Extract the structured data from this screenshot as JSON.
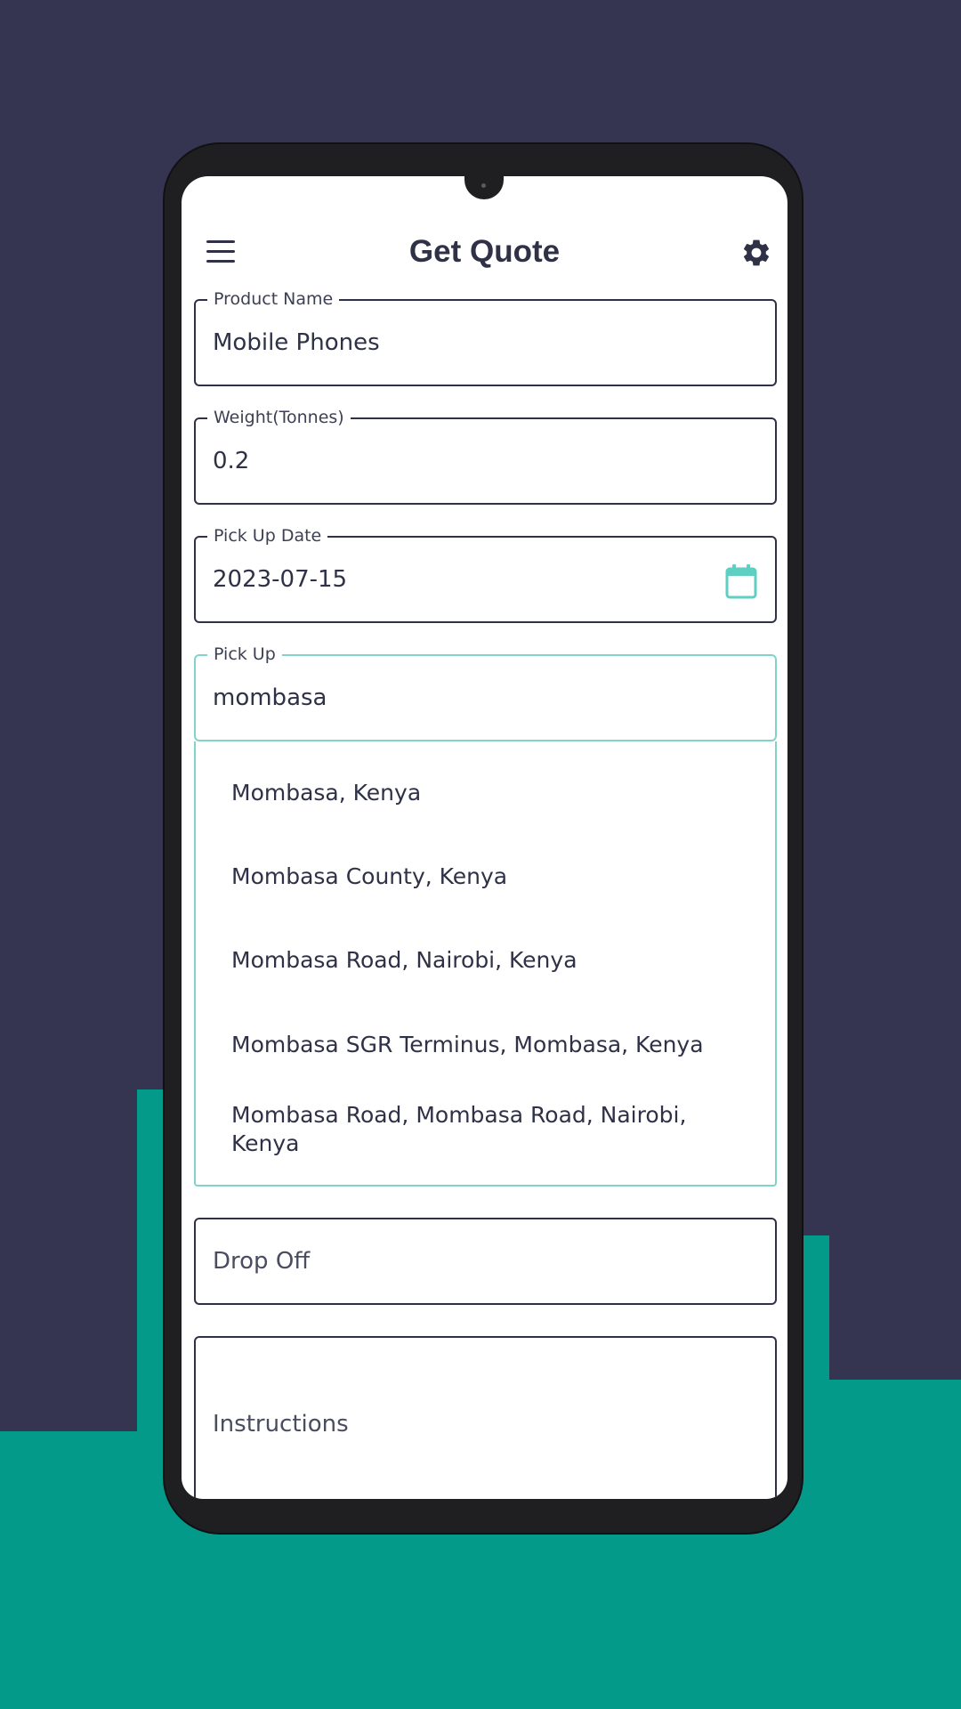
{
  "header": {
    "title": "Get Quote",
    "menu_icon": "hamburger-menu-icon",
    "settings_icon": "gear-icon"
  },
  "form": {
    "product_name": {
      "label": "Product Name",
      "value": "Mobile Phones"
    },
    "weight": {
      "label": "Weight(Tonnes)",
      "value": "0.2"
    },
    "pickup_date": {
      "label": "Pick Up Date",
      "value": "2023-07-15",
      "icon": "calendar-icon"
    },
    "pickup": {
      "label": "Pick Up",
      "value": "mombasa"
    },
    "dropoff": {
      "placeholder": "Drop Off"
    },
    "instructions": {
      "placeholder": "Instructions"
    }
  },
  "suggestions": [
    "Mombasa, Kenya",
    "Mombasa County, Kenya",
    "Mombasa Road, Nairobi, Kenya",
    "Mombasa SGR Terminus, Mombasa, Kenya",
    "Mombasa Road, Mombasa Road, Nairobi, Kenya"
  ],
  "colors": {
    "background": "#353551",
    "accent": "#049a8a",
    "focus_border": "#7fd3c8",
    "text": "#2f3147"
  }
}
